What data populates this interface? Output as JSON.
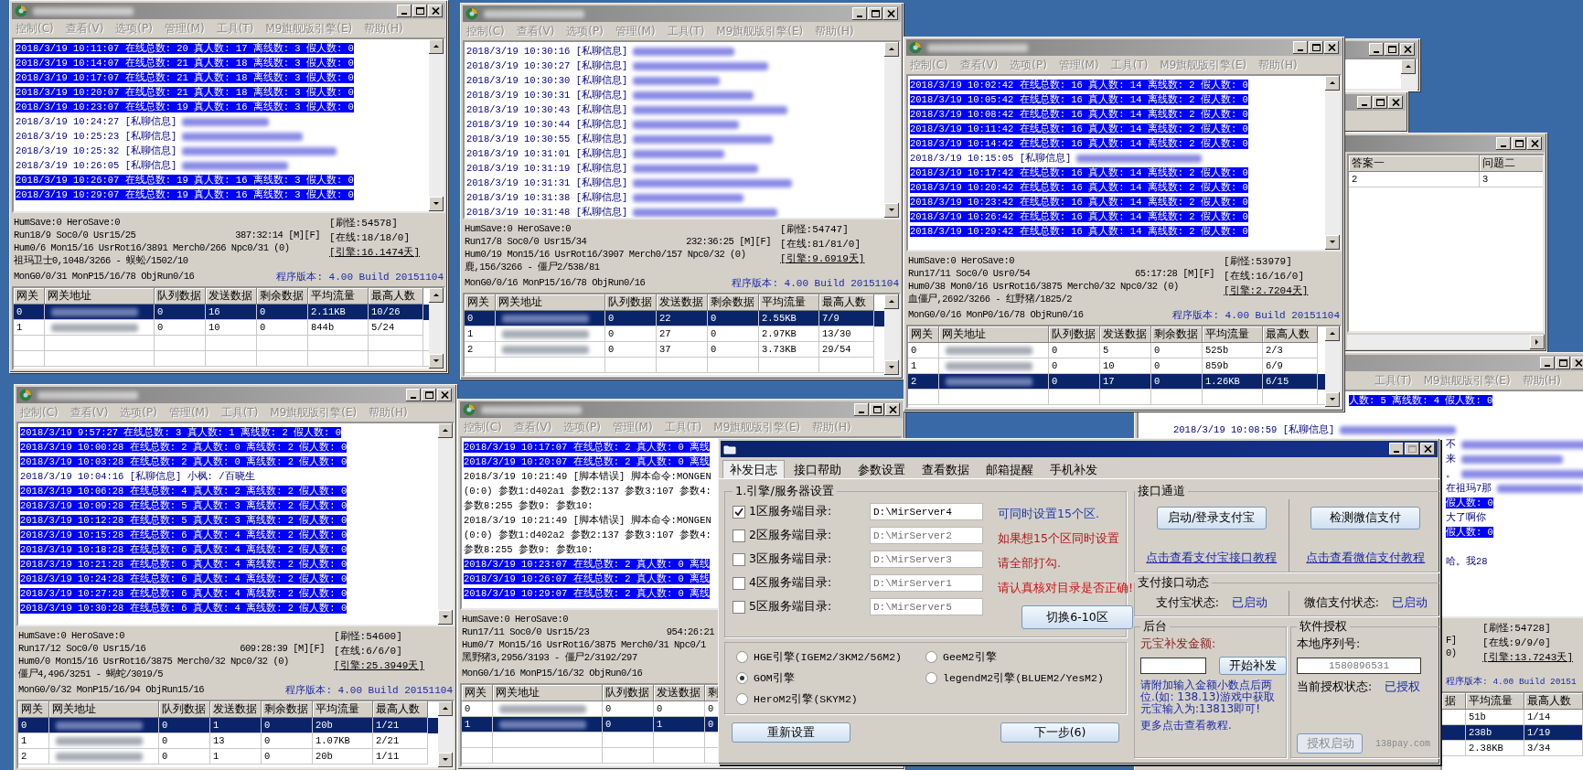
{
  "server_windows": [
    {
      "menu": [
        "控制(C)",
        "查看(V)",
        "选项(P)",
        "管理(M)",
        "工具(T)",
        "M9旗舰版引擎(E)",
        "帮助(H)"
      ],
      "log": [
        {
          "kind": "stat",
          "text": "2018/3/19 10:11:07 在线总数: 20 真人数: 17 离线数: 3 假人数: 0"
        },
        {
          "kind": "stat",
          "text": "2018/3/19 10:14:07 在线总数: 21 真人数: 18 离线数: 3 假人数: 0"
        },
        {
          "kind": "stat",
          "text": "2018/3/19 10:17:07 在线总数: 21 真人数: 18 离线数: 3 假人数: 0"
        },
        {
          "kind": "stat",
          "text": "2018/3/19 10:20:07 在线总数: 21 真人数: 18 离线数: 3 假人数: 0"
        },
        {
          "kind": "stat",
          "text": "2018/3/19 10:23:07 在线总数: 19 真人数: 16 离线数: 3 假人数: 0"
        },
        {
          "kind": "chat",
          "text": "2018/3/19 10:24:27 [私聊信息]",
          "redacted": true
        },
        {
          "kind": "chat",
          "text": "2018/3/19 10:25:23 [私聊信息]",
          "redacted": true
        },
        {
          "kind": "chat",
          "text": "2018/3/19 10:25:32 [私聊信息]",
          "redacted": true
        },
        {
          "kind": "chat",
          "text": "2018/3/19 10:26:05 [私聊信息]",
          "redacted": true
        },
        {
          "kind": "stat",
          "text": "2018/3/19 10:26:07 在线总数: 19 真人数: 16 离线数: 3 假人数: 0"
        },
        {
          "kind": "stat",
          "text": "2018/3/19 10:29:07 在线总数: 19 真人数: 16 离线数: 3 假人数: 0"
        }
      ],
      "status": {
        "lines": [
          "HumSave:0 HeroSave:0",
          "Run18/9 Soc0/0 Usr15/25",
          "Hum0/6 Mon15/16 UsrRot16/3891 Merch0/266 Npc0/31 (0)",
          "祖玛卫士0,1048/3266 - 蜈蚣/1502/10",
          "MonG0/0/31 MonP15/16/78 ObjRun0/16"
        ],
        "uptime": "387:32:14 [M][F]",
        "right": {
          "monsters": "[刷怪:54578]",
          "online": "[在线:18/18/0]",
          "engine": "[引擎:16.1474天]",
          "version": "程序版本: 4.00 Build 20151104"
        }
      },
      "table": {
        "columns": [
          "网关",
          "网关地址",
          "队列数据",
          "发送数据",
          "剩余数据",
          "平均流量",
          "最高人数"
        ],
        "rows": [
          {
            "selected": true,
            "cells": [
              "0",
              "",
              "0",
              "16",
              "0",
              "2.11KB",
              "10/26"
            ]
          },
          {
            "selected": false,
            "cells": [
              "1",
              "",
              "0",
              "10",
              "0",
              "844b",
              "5/24"
            ]
          }
        ]
      }
    },
    {
      "menu": [
        "控制(C)",
        "查看(V)",
        "选项(P)",
        "管理(M)",
        "工具(T)",
        "M9旗舰版引擎(E)",
        "帮助(H)"
      ],
      "log": [
        {
          "kind": "chat",
          "text": "2018/3/19 10:30:16 [私聊信息]",
          "redacted": true
        },
        {
          "kind": "chat",
          "text": "2018/3/19 10:30:27 [私聊信息]",
          "redacted": true
        },
        {
          "kind": "chat",
          "text": "2018/3/19 10:30:30 [私聊信息]",
          "redacted": true
        },
        {
          "kind": "chat",
          "text": "2018/3/19 10:30:31 [私聊信息]",
          "redacted": true
        },
        {
          "kind": "chat",
          "text": "2018/3/19 10:30:43 [私聊信息]",
          "redacted": true
        },
        {
          "kind": "chat",
          "text": "2018/3/19 10:30:44 [私聊信息]",
          "redacted": true
        },
        {
          "kind": "chat",
          "text": "2018/3/19 10:30:55 [私聊信息]",
          "redacted": true
        },
        {
          "kind": "chat",
          "text": "2018/3/19 10:31:01 [私聊信息]",
          "redacted": true
        },
        {
          "kind": "chat",
          "text": "2018/3/19 10:31:19 [私聊信息]",
          "redacted": true
        },
        {
          "kind": "chat",
          "text": "2018/3/19 10:31:31 [私聊信息]",
          "redacted": true
        },
        {
          "kind": "chat",
          "text": "2018/3/19 10:31:38 [私聊信息]",
          "redacted": true
        },
        {
          "kind": "chat",
          "text": "2018/3/19 10:31:48 [私聊信息]",
          "redacted": true
        }
      ],
      "status": {
        "lines": [
          "HumSave:0 HeroSave:0",
          "Run17/8 Soc0/0 Usr15/34",
          "Hum0/19 Mon15/16 UsrRot16/3907 Merch0/157 Npc0/32 (0)",
          "鹿,156/3266 - 僵尸2/538/81",
          "MonG0/0/16 MonP15/16/78 ObjRun0/16"
        ],
        "uptime": "232:36:25 [M][F]",
        "right": {
          "monsters": "[刷怪:54747]",
          "online": "[在线:81/81/0]",
          "engine": "[引擎:9.6919天]",
          "version": "程序版本: 4.00 Build 20151104"
        }
      },
      "table": {
        "columns": [
          "网关",
          "网关地址",
          "队列数据",
          "发送数据",
          "剩余数据",
          "平均流量",
          "最高人数"
        ],
        "rows": [
          {
            "selected": true,
            "cells": [
              "0",
              "",
              "0",
              "22",
              "0",
              "2.55KB",
              "7/9"
            ]
          },
          {
            "selected": false,
            "cells": [
              "1",
              "",
              "0",
              "27",
              "0",
              "2.97KB",
              "13/30"
            ]
          },
          {
            "selected": false,
            "cells": [
              "2",
              "",
              "0",
              "37",
              "0",
              "3.73KB",
              "29/54"
            ]
          }
        ]
      }
    },
    {
      "menu": [
        "控制(C)",
        "查看(V)",
        "选项(P)",
        "管理(M)",
        "工具(T)",
        "M9旗舰版引擎(E)",
        "帮助(H)"
      ],
      "log": [
        {
          "kind": "stat",
          "text": "2018/3/19 10:02:42 在线总数: 16 真人数: 14 离线数: 2 假人数: 0"
        },
        {
          "kind": "stat",
          "text": "2018/3/19 10:05:42 在线总数: 16 真人数: 14 离线数: 2 假人数: 0"
        },
        {
          "kind": "stat",
          "text": "2018/3/19 10:08:42 在线总数: 16 真人数: 14 离线数: 2 假人数: 0"
        },
        {
          "kind": "stat",
          "text": "2018/3/19 10:11:42 在线总数: 16 真人数: 14 离线数: 2 假人数: 0"
        },
        {
          "kind": "stat",
          "text": "2018/3/19 10:14:42 在线总数: 16 真人数: 14 离线数: 2 假人数: 0"
        },
        {
          "kind": "chat",
          "text": "2018/3/19 10:15:05 [私聊信息]",
          "redacted": true
        },
        {
          "kind": "stat",
          "text": "2018/3/19 10:17:42 在线总数: 16 真人数: 14 离线数: 2 假人数: 0"
        },
        {
          "kind": "stat",
          "text": "2018/3/19 10:20:42 在线总数: 16 真人数: 14 离线数: 2 假人数: 0"
        },
        {
          "kind": "stat",
          "text": "2018/3/19 10:23:42 在线总数: 16 真人数: 14 离线数: 2 假人数: 0"
        },
        {
          "kind": "stat",
          "text": "2018/3/19 10:26:42 在线总数: 16 真人数: 14 离线数: 2 假人数: 0"
        },
        {
          "kind": "stat",
          "text": "2018/3/19 10:29:42 在线总数: 16 真人数: 14 离线数: 2 假人数: 0"
        }
      ],
      "status": {
        "lines": [
          "HumSave:0 HeroSave:0",
          "Run17/11 Soc0/0 Usr0/54",
          "Hum0/38 Mon0/16 UsrRot16/3875 Merch0/32 Npc0/32 (0)",
          "血僵尸,2692/3266 - 红野猪/1825/2",
          "MonG0/0/16 MonP0/16/78 ObjRun0/16"
        ],
        "uptime": "65:17:28 [M][F]",
        "right": {
          "monsters": "[刷怪:53979]",
          "online": "[在线:16/16/0]",
          "engine": "[引擎:2.7204天]",
          "version": "程序版本: 4.00 Build 20151104"
        }
      },
      "table": {
        "columns": [
          "网关",
          "网关地址",
          "队列数据",
          "发送数据",
          "剩余数据",
          "平均流量",
          "最高人数"
        ],
        "rows": [
          {
            "selected": false,
            "cells": [
              "0",
              "",
              "0",
              "5",
              "0",
              "525b",
              "2/3"
            ]
          },
          {
            "selected": false,
            "cells": [
              "1",
              "",
              "0",
              "10",
              "0",
              "859b",
              "6/9"
            ]
          },
          {
            "selected": true,
            "cells": [
              "2",
              "",
              "0",
              "17",
              "0",
              "1.26KB",
              "6/15"
            ]
          }
        ]
      }
    },
    {
      "menu": [
        "控制(C)",
        "查看(V)",
        "选项(P)",
        "管理(M)",
        "工具(T)",
        "M9旗舰版引擎(E)",
        "帮助(H)"
      ],
      "log": [
        {
          "kind": "stat",
          "text": "2018/3/19 9:57:27 在线总数: 3 真人数: 1 离线数: 2 假人数: 0"
        },
        {
          "kind": "stat",
          "text": "2018/3/19 10:00:28 在线总数: 2 真人数: 0 离线数: 2 假人数: 0"
        },
        {
          "kind": "stat",
          "text": "2018/3/19 10:03:28 在线总数: 2 真人数: 0 离线数: 2 假人数: 0"
        },
        {
          "kind": "chat",
          "text": "2018/3/19 10:04:16 [私聊信息] 小枫: /百晓生"
        },
        {
          "kind": "stat",
          "text": "2018/3/19 10:06:28 在线总数: 4 真人数: 2 离线数: 2 假人数: 0"
        },
        {
          "kind": "stat",
          "text": "2018/3/19 10:09:28 在线总数: 5 真人数: 3 离线数: 2 假人数: 0"
        },
        {
          "kind": "stat",
          "text": "2018/3/19 10:12:28 在线总数: 5 真人数: 3 离线数: 2 假人数: 0"
        },
        {
          "kind": "stat",
          "text": "2018/3/19 10:15:28 在线总数: 6 真人数: 4 离线数: 2 假人数: 0"
        },
        {
          "kind": "stat",
          "text": "2018/3/19 10:18:28 在线总数: 6 真人数: 4 离线数: 2 假人数: 0"
        },
        {
          "kind": "stat",
          "text": "2018/3/19 10:21:28 在线总数: 6 真人数: 4 离线数: 2 假人数: 0"
        },
        {
          "kind": "stat",
          "text": "2018/3/19 10:24:28 在线总数: 6 真人数: 4 离线数: 2 假人数: 0"
        },
        {
          "kind": "stat",
          "text": "2018/3/19 10:27:28 在线总数: 6 真人数: 4 离线数: 2 假人数: 0"
        },
        {
          "kind": "stat",
          "text": "2018/3/19 10:30:28 在线总数: 6 真人数: 4 离线数: 2 假人数: 0"
        }
      ],
      "status": {
        "lines": [
          "HumSave:0 HeroSave:0",
          "Run17/12 Soc0/0 Usr15/16",
          "Hum0/0 Mon15/16 UsrRot16/3875 Merch0/32 Npc0/32 (0)",
          "僵尸4,496/3251 - 蝎蛇/3019/5",
          "MonG0/0/32 MonP15/16/94 ObjRun15/16"
        ],
        "uptime": "609:28:39 [M][F]",
        "right": {
          "monsters": "[刷怪:54600]",
          "online": "[在线:6/6/0]",
          "engine": "[引擎:25.3949天]",
          "version": "程序版本: 4.00 Build 20151104"
        }
      },
      "table": {
        "columns": [
          "网关",
          "网关地址",
          "队列数据",
          "发送数据",
          "剩余数据",
          "平均流量",
          "最高人数"
        ],
        "rows": [
          {
            "selected": true,
            "cells": [
              "0",
              "",
              "0",
              "1",
              "0",
              "20b",
              "1/21"
            ]
          },
          {
            "selected": false,
            "cells": [
              "1",
              "",
              "0",
              "13",
              "0",
              "1.07KB",
              "2/21"
            ]
          },
          {
            "selected": false,
            "cells": [
              "2",
              "",
              "0",
              "1",
              "0",
              "20b",
              "1/11"
            ]
          }
        ]
      }
    },
    {
      "menu": [
        "控制(C)",
        "查看(V)",
        "选项(P)",
        "管理(M)",
        "工具(T)",
        "M9旗舰版引擎(E)",
        "帮助(H)"
      ],
      "log": [
        {
          "kind": "stat",
          "text": "2018/3/19 10:17:07 在线总数: 2 真人数: 0 离线"
        },
        {
          "kind": "stat",
          "text": "2018/3/19 10:20:07 在线总数: 2 真人数: 0 离线"
        },
        {
          "kind": "error",
          "text": "2018/3/19 10:21:49 [脚本错误] 脚本命令:MONGEN"
        },
        {
          "kind": "error",
          "text": "(0:0) 参数1:d402a1 参数2:137 参数3:107 参数4:"
        },
        {
          "kind": "error",
          "text": "参数8:255 参数9: 参数10:"
        },
        {
          "kind": "error",
          "text": "2018/3/19 10:21:49 [脚本错误] 脚本命令:MONGEN"
        },
        {
          "kind": "error",
          "text": "(0:0) 参数1:d402a2 参数2:137 参数3:107 参数4:"
        },
        {
          "kind": "error",
          "text": "参数8:255 参数9: 参数10:"
        },
        {
          "kind": "stat",
          "text": "2018/3/19 10:23:07 在线总数: 2 真人数: 0 离线"
        },
        {
          "kind": "stat",
          "text": "2018/3/19 10:26:07 在线总数: 2 真人数: 0 离线"
        },
        {
          "kind": "stat",
          "text": "2018/3/19 10:29:07 在线总数: 2 真人数: 0 离线"
        }
      ],
      "status": {
        "lines": [
          "HumSave:0 HeroSave:0",
          "Run17/11 Soc0/0 Usr15/23",
          "Hum0/7 Mon15/16 UsrRot16/3875 Merch0/31 Npc0/1",
          "黑野猪3,2956/3193 - 僵尸2/3192/297",
          "MonG0/1/16 MonP15/16/32 ObjRun0/16"
        ],
        "uptime": "954:26:21"
      },
      "table": {
        "columns": [
          "网关",
          "网关地址",
          "队列数据",
          "发送数据",
          "剩"
        ],
        "rows": [
          {
            "selected": false,
            "cells": [
              "0",
              "",
              "0",
              "0",
              "0"
            ]
          },
          {
            "selected": true,
            "cells": [
              "1",
              "",
              "0",
              "1",
              "0"
            ]
          }
        ]
      }
    }
  ],
  "answer_window": {
    "columns": [
      "答案一",
      "问题二"
    ],
    "rows": [
      [
        "2",
        "3"
      ]
    ]
  },
  "side_window": {
    "menu": [
      "工具(T)",
      "M9旗舰版引擎(E)",
      "帮助(H)"
    ],
    "log": [
      {
        "kind": "stat",
        "text": "人数: 5 离线数: 4 假人数: 0"
      },
      {
        "kind": "chat",
        "text": "2018/3/19 10:08:59 [私聊信息]",
        "redacted": true
      },
      {
        "kind": "chat",
        "text": "不",
        "redacted": true
      },
      {
        "kind": "chat",
        "text": "来",
        "redacted": true
      },
      {
        "kind": "chat",
        "text": "。",
        "redacted": true
      },
      {
        "kind": "chat",
        "text": "在祖玛7那",
        "redacted": true
      },
      {
        "kind": "stat",
        "text": "假人数: 0"
      },
      {
        "kind": "chat",
        "text": "大了啊你"
      },
      {
        "kind": "stat",
        "text": "假人数: 0"
      },
      {
        "kind": "chat",
        "text": "哈。我28"
      }
    ],
    "status_tails": [
      "F]",
      "0)"
    ],
    "right": {
      "monsters": "[刷怪:54728]",
      "online": "[在线:9/9/0]",
      "engine": "[引擎:13.7243天]",
      "version": "程序版本: 4.00 Build 20151"
    },
    "table": {
      "columns": [
        "据",
        "平均流量",
        "最高人数"
      ],
      "rows": [
        {
          "selected": false,
          "cells": [
            "",
            "51b",
            "1/14"
          ]
        },
        {
          "selected": true,
          "cells": [
            "",
            "238b",
            "1/19"
          ]
        },
        {
          "selected": false,
          "cells": [
            "",
            "2.38KB",
            "3/34"
          ]
        }
      ]
    }
  },
  "dialog": {
    "tabs": [
      {
        "label": "补发日志",
        "selected": true
      },
      {
        "label": "接口帮助",
        "selected": false
      },
      {
        "label": "参数设置",
        "selected": false
      },
      {
        "label": "查看数据",
        "selected": false
      },
      {
        "label": "邮箱提醒",
        "selected": false
      },
      {
        "label": "手机补发",
        "selected": false
      }
    ],
    "server_group": {
      "title": "1.引擎/服务器设置",
      "rows": [
        {
          "label": "1区服务端目录:",
          "checked": true,
          "value": "D:\\MirServer4",
          "disabled": false
        },
        {
          "label": "2区服务端目录:",
          "checked": false,
          "value": "D:\\MirServer2",
          "disabled": true
        },
        {
          "label": "3区服务端目录:",
          "checked": false,
          "value": "D:\\MirServer3",
          "disabled": true
        },
        {
          "label": "4区服务端目录:",
          "checked": false,
          "value": "D:\\MirServer1",
          "disabled": true
        },
        {
          "label": "5区服务端目录:",
          "checked": false,
          "value": "D:\\MirServer5",
          "disabled": true
        }
      ],
      "notes": [
        {
          "text": "可同时设置15个区.",
          "color": "#1c3aa8"
        },
        {
          "text": "如果想15个区同时设置",
          "color": "#b01818"
        },
        {
          "text": "请全部打勾.",
          "color": "#b01818"
        },
        {
          "text": "请认真核对目录是否正确!",
          "color": "#d01010"
        }
      ],
      "switch_button": "切换6-10区"
    },
    "engines": [
      {
        "label": "HGE引擎(IGEM2/3KM2/56M2)",
        "selected": false
      },
      {
        "label": "GeeM2引擎",
        "selected": false
      },
      {
        "label": "GOM引擎",
        "selected": true
      },
      {
        "label": "legendM2引擎(BLUEM2/YesM2)",
        "selected": false
      },
      {
        "label": "HeroM2引擎(SKYM2)",
        "selected": false
      }
    ],
    "buttons": [
      "重新设置",
      "下一步(6)"
    ],
    "channel": {
      "title": "接口通道",
      "buttons": [
        "启动/登录支付宝",
        "检测微信支付"
      ],
      "links": [
        "点击查看支付宝接口教程",
        "点击查看微信支付教程"
      ]
    },
    "pay_status": {
      "title": "支付接口动态",
      "items": [
        {
          "label": "支付宝状态:",
          "value": "已启动"
        },
        {
          "label": "微信支付状态:",
          "value": "已启动"
        }
      ]
    },
    "backend": {
      "title": "后台",
      "amount_label": "元宝补发金额:",
      "start_button": "开始补发",
      "note": "请附加输入金额小数点后两位.(如: 138.13)游戏中获取元宝输入为:13813即可!",
      "note_more": "更多点击查看教程."
    },
    "license": {
      "title": "软件授权",
      "serial_label": "本地序列号:",
      "serial": "1580896531",
      "status_label": "当前授权状态:",
      "status": "已授权",
      "button": "授权启动",
      "button_disabled": true,
      "site": "138pay.com"
    }
  }
}
